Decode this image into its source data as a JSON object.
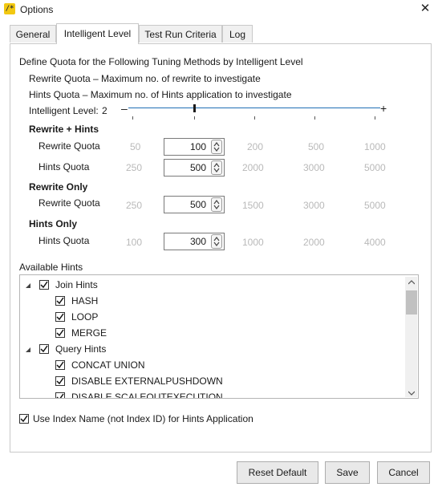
{
  "window": {
    "title": "Options",
    "icon": "app-logo-icon",
    "close": "close-icon"
  },
  "tabs": [
    {
      "label": "General",
      "active": false
    },
    {
      "label": "Intelligent Level",
      "active": true
    },
    {
      "label": "Test Run Criteria",
      "active": false
    },
    {
      "label": "Log",
      "active": false
    }
  ],
  "intro": {
    "line1": "Define Quota for the Following Tuning Methods by Intelligent Level",
    "line2": "Rewrite Quota – Maximum no. of rewrite to investigate",
    "line3": "Hints Quota – Maximum no. of Hints application to investigate"
  },
  "level": {
    "label": "Intelligent Level:",
    "value": "2",
    "minus": "–",
    "plus": "+",
    "position_fraction": 0.25
  },
  "groups": {
    "rewrite_hints": {
      "title": "Rewrite + Hints",
      "rewrite": {
        "label": "Rewrite Quota",
        "low": "50",
        "value": "100",
        "levels": [
          "200",
          "500",
          "1000"
        ]
      },
      "hints": {
        "label": "Hints Quota",
        "low": "250",
        "value": "500",
        "levels": [
          "2000",
          "3000",
          "5000"
        ]
      }
    },
    "rewrite_only": {
      "title": "Rewrite Only",
      "rewrite": {
        "label": "Rewrite Quota",
        "low": "250",
        "value": "500",
        "levels": [
          "1500",
          "3000",
          "5000"
        ]
      }
    },
    "hints_only": {
      "title": "Hints Only",
      "hints": {
        "label": "Hints Quota",
        "low": "100",
        "value": "300",
        "levels": [
          "1000",
          "2000",
          "4000"
        ]
      }
    }
  },
  "hints": {
    "label": "Available Hints",
    "items": [
      {
        "label": "Join Hints",
        "checked": true
      },
      {
        "label": "HASH",
        "checked": true
      },
      {
        "label": "LOOP",
        "checked": true
      },
      {
        "label": "MERGE",
        "checked": true
      },
      {
        "label": "Query Hints",
        "checked": true
      },
      {
        "label": "CONCAT UNION",
        "checked": true
      },
      {
        "label": "DISABLE EXTERNALPUSHDOWN",
        "checked": true
      },
      {
        "label": "DISABLE SCALEOUTEXECUTION",
        "checked": true
      }
    ]
  },
  "use_index_name": {
    "label": "Use Index Name (not Index ID) for Hints Application",
    "checked": true
  },
  "buttons": {
    "reset": "Reset Default",
    "save": "Save",
    "cancel": "Cancel"
  }
}
